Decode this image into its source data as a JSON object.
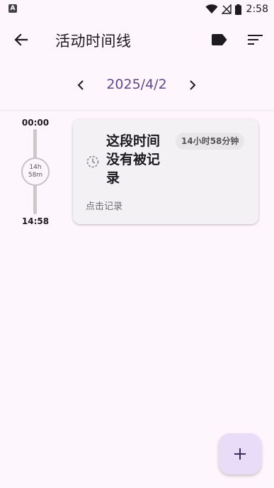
{
  "status_bar": {
    "left_icon_letter": "A",
    "time": "2:58",
    "icons": [
      "wifi-icon",
      "no-signal-icon",
      "battery-icon"
    ]
  },
  "app_bar": {
    "title": "活动时间线",
    "back_icon": "arrow-left-icon",
    "label_icon": "label-tag-icon",
    "sort_icon": "sort-icon"
  },
  "date_nav": {
    "date": "2025/4/2",
    "prev_icon": "chevron-left-icon",
    "next_icon": "chevron-right-icon"
  },
  "timeline": {
    "start_time": "00:00",
    "end_time": "14:58",
    "duration_hours": "14h",
    "duration_minutes": "58m"
  },
  "card": {
    "title": "这段时间没有被记录",
    "duration_badge": "14小时58分钟",
    "hint": "点击记录",
    "icon": "clock-dashed-icon"
  },
  "fab": {
    "icon": "plus-icon"
  },
  "colors": {
    "background": "#fdf6fc",
    "accent": "#5f4b8b",
    "fab_bg": "#e8dcf8",
    "card_bg": "#f4f1f5"
  }
}
